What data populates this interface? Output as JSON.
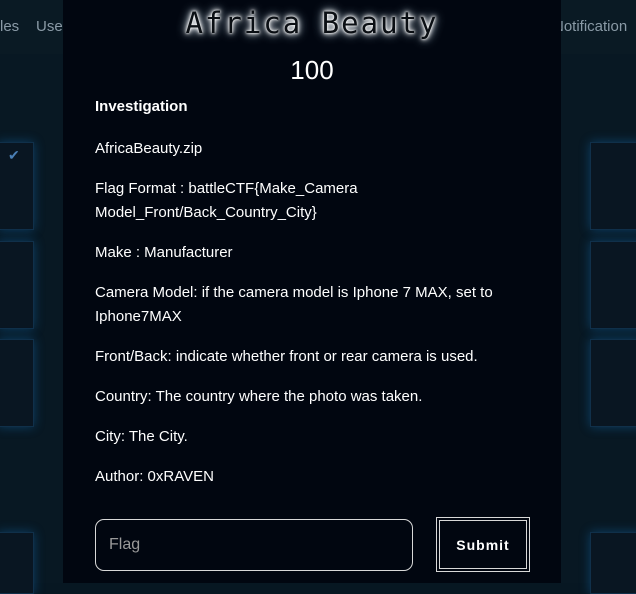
{
  "background": {
    "nav_items": [
      "les",
      "Use",
      "Notification"
    ]
  },
  "challenge": {
    "title": "Africa Beauty",
    "value": "100",
    "category": "Investigation",
    "description": [
      "AfricaBeauty.zip",
      "Flag Format : battleCTF{Make_Camera Model_Front/Back_Country_City}",
      "Make : Manufacturer",
      "Camera Model: if the camera model is Iphone 7 MAX, set to Iphone7MAX",
      "Front/Back: indicate whether front or rear camera is used.",
      "Country: The country where the photo was taken.",
      "City: The City.",
      "Author: 0xRAVEN"
    ]
  },
  "form": {
    "flag_placeholder": "Flag",
    "submit_label": "Submit"
  },
  "icons": {
    "solved_check": "checkmark-icon"
  },
  "colors": {
    "background": "#071722",
    "modal": "#010610",
    "card_glow": "#146eb4",
    "text": "#ffffff"
  }
}
